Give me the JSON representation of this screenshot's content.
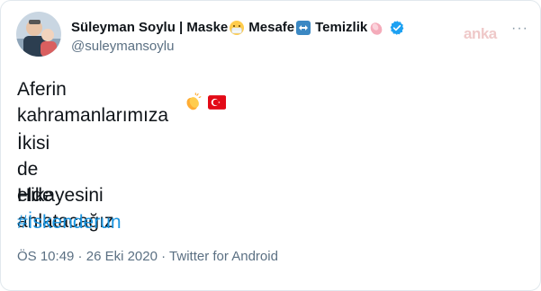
{
  "author": {
    "name_part1": "Süleyman Soylu | Maske",
    "name_part2": "Mesafe",
    "name_part3": "Temizlik",
    "handle": "@suleymansoylu",
    "verified": true
  },
  "watermark": "anka",
  "more_menu": "···",
  "tweet": {
    "line1": "Aferin kahramanlarımıza",
    "line2": "İkisi de elde",
    "line3": "Hikayesini anlatacağız",
    "hashtag": "#İskenderun"
  },
  "meta": {
    "time": "ÖS 10:49",
    "dot1": " · ",
    "date": "26 Eki 2020",
    "dot2": " · ",
    "source": "Twitter for Android"
  },
  "colors": {
    "link": "#1b95e0",
    "verified": "#1da1f2",
    "secondary_text": "#5b7083"
  },
  "icons": [
    "mask-emoji-icon",
    "left-right-arrow-icon",
    "soap-icon",
    "verified-badge-icon",
    "clapping-hands-icon",
    "turkey-flag-icon",
    "more-icon"
  ]
}
